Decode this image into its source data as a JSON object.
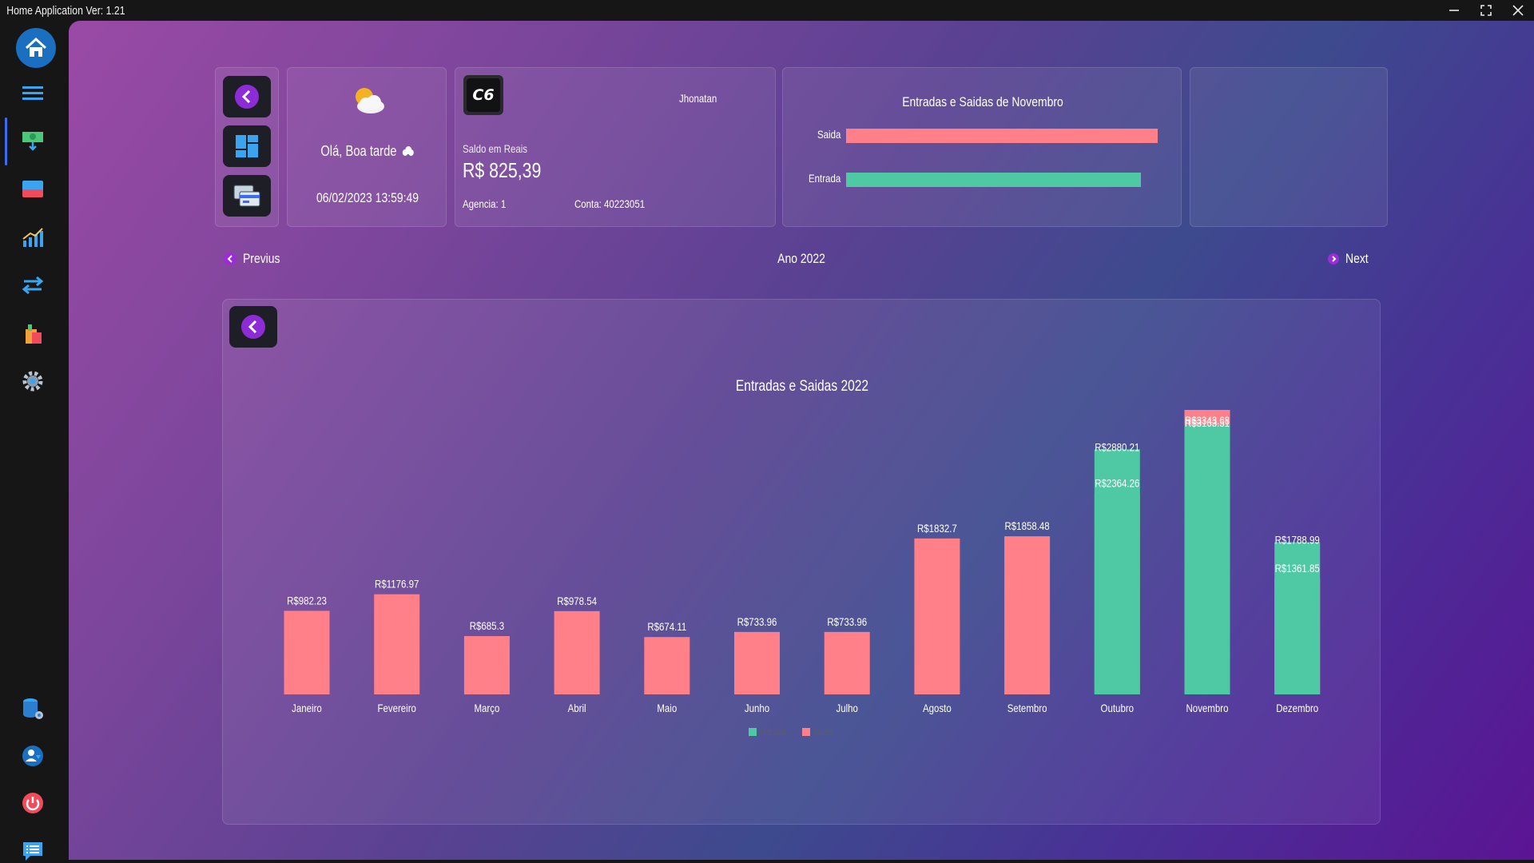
{
  "window": {
    "title": "Home Application Ver: 1.21"
  },
  "sidebar": {
    "items": [
      {
        "icon": "home-icon"
      },
      {
        "icon": "menu-icon"
      },
      {
        "icon": "income-icon"
      },
      {
        "icon": "card-icon"
      },
      {
        "icon": "growth-chart-icon"
      },
      {
        "icon": "transfer-icon"
      },
      {
        "icon": "shopping-icon"
      },
      {
        "icon": "settings-gear-icon"
      },
      {
        "icon": "database-settings-icon"
      },
      {
        "icon": "user-icon"
      },
      {
        "icon": "power-icon"
      },
      {
        "icon": "messages-icon"
      }
    ]
  },
  "greeting": {
    "text": "Olá, Boa tarde",
    "datetime": "06/02/2023 13:59:49"
  },
  "account": {
    "bank_logo": "C6",
    "owner": "Jhonatan",
    "balance_label": "Saldo em Reais",
    "balance": "R$ 825,39",
    "agency": "Agencia: 1",
    "account_number": "Conta: 40223051"
  },
  "month_summary": {
    "title": "Entradas e Saidas de Novembro",
    "saida_label": "Saida",
    "entrada_label": "Entrada",
    "saida_color": "#ff8088",
    "entrada_color": "#4fc9a3",
    "saida_value": 3343.68,
    "entrada_value": 3163.51
  },
  "year_nav": {
    "prev_label": "Previus",
    "year_label": "Ano 2022",
    "next_label": "Next"
  },
  "chart_data": {
    "type": "bar",
    "title": "Entradas e Saidas 2022",
    "categories": [
      "Janeiro",
      "Fevereiro",
      "Março",
      "Abril",
      "Maio",
      "Junho",
      "Julho",
      "Agosto",
      "Setembro",
      "Outubro",
      "Novembro",
      "Dezembro"
    ],
    "series": [
      {
        "name": "entrada",
        "color": "#4fc9a3",
        "values": [
          0,
          0,
          0,
          0,
          0,
          0,
          0,
          0,
          0,
          2880.21,
          3163.51,
          1788.99
        ]
      },
      {
        "name": "saida",
        "color": "#ff8088",
        "values": [
          982.23,
          1176.97,
          685.3,
          978.54,
          674.11,
          733.96,
          733.96,
          1832.7,
          1858.48,
          2364.26,
          3343.68,
          1361.85
        ]
      }
    ],
    "saida_labels": [
      "R$982.23",
      "R$1176.97",
      "R$685.3",
      "R$978.54",
      "R$674.11",
      "R$733.96",
      "R$733.96",
      "R$1832.7",
      "R$1858.48",
      "R$2364.26",
      "R$3343.68",
      "R$1361.85"
    ],
    "entrada_labels": [
      "",
      "",
      "",
      "",
      "",
      "",
      "",
      "",
      "",
      "R$2880.21",
      "R$3163.51",
      "R$1788.99"
    ],
    "legend": [
      "entrada",
      "saida"
    ],
    "legend_position": "bottom-center",
    "grid": false
  }
}
